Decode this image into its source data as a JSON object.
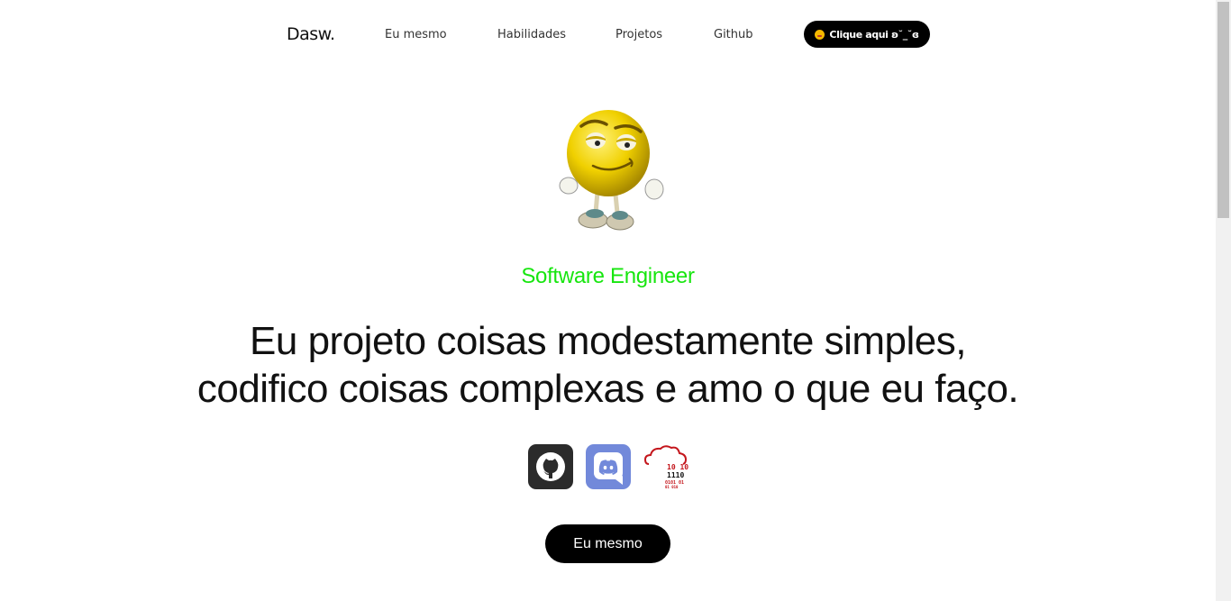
{
  "nav": {
    "logo": "Dasw.",
    "links": [
      "Eu mesmo",
      "Habilidades",
      "Projetos",
      "Github"
    ],
    "cta_label": "Clique aqui ʚ˘_˘ɞ"
  },
  "hero": {
    "role": "Software Engineer",
    "headline_line1": "Eu projeto coisas modestamente simples,",
    "headline_line2": "codifico coisas complexas e amo o que eu faço.",
    "cloud_icon_text": [
      "10 10",
      "1110",
      "0101 01",
      "01 010"
    ],
    "button_label": "Eu mesmo"
  },
  "colors": {
    "accent_green": "#17e60f",
    "button_black": "#000000",
    "discord_blue": "#7289da",
    "github_dark": "#2b2b2b",
    "cloud_red": "#c4161c"
  },
  "icons": {
    "avatar": "yellow-emoji-character-icon",
    "social": [
      "github-icon",
      "discord-icon",
      "cloud-binary-icon"
    ]
  }
}
